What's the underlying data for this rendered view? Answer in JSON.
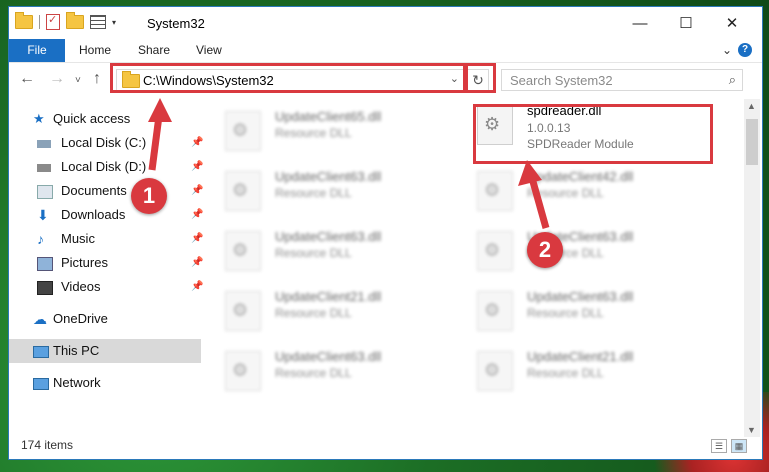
{
  "window": {
    "title": "System32",
    "controls": {
      "minimize": "—",
      "maximize": "☐",
      "close": "✕"
    }
  },
  "ribbon": {
    "file": "File",
    "tabs": [
      "Home",
      "Share",
      "View"
    ]
  },
  "navigation": {
    "back": "←",
    "forward": "→",
    "recent": "˅",
    "up": "↑",
    "address": "C:\\Windows\\System32",
    "refresh": "↻",
    "search_placeholder": "Search System32"
  },
  "sidebar": {
    "quick_access": "Quick access",
    "items": [
      {
        "label": "Local Disk (C:)",
        "icon": "drive-icon",
        "pinned": true
      },
      {
        "label": "Local Disk (D:)",
        "icon": "drive-icon",
        "pinned": true
      },
      {
        "label": "Documents",
        "icon": "documents-icon",
        "pinned": true
      },
      {
        "label": "Downloads",
        "icon": "downloads-icon",
        "pinned": true
      },
      {
        "label": "Music",
        "icon": "music-icon",
        "pinned": true
      },
      {
        "label": "Pictures",
        "icon": "pictures-icon",
        "pinned": true
      },
      {
        "label": "Videos",
        "icon": "videos-icon",
        "pinned": true
      }
    ],
    "onedrive": "OneDrive",
    "this_pc": "This PC",
    "network": "Network"
  },
  "files": {
    "left": [
      {
        "name": "UpdateClient65.dll",
        "type": "Resource DLL"
      },
      {
        "name": "UpdateClient63.dll",
        "type": "Resource DLL"
      },
      {
        "name": "UpdateClient63.dll",
        "type": "Resource DLL"
      },
      {
        "name": "UpdateClient21.dll",
        "type": "Resource DLL"
      },
      {
        "name": "UpdateClient63.dll",
        "type": "Resource DLL"
      }
    ],
    "highlighted": {
      "name": "spdreader.dll",
      "version": "1.0.0.13",
      "description": "SPDReader Module"
    },
    "right": [
      {
        "name": "UpdateClient42.dll",
        "type": "Resource DLL"
      },
      {
        "name": "UpdateClient63.dll",
        "type": "Resource DLL"
      },
      {
        "name": "UpdateClient63.dll",
        "type": "Resource DLL"
      },
      {
        "name": "UpdateClient21.dll",
        "type": "Resource DLL"
      }
    ]
  },
  "status": {
    "count": "174 items"
  },
  "annotations": {
    "marker1": "1",
    "marker2": "2",
    "color": "#d9393f"
  }
}
